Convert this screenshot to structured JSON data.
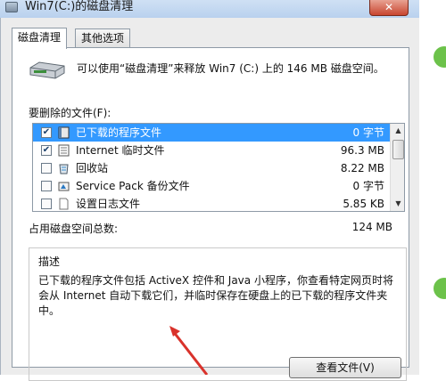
{
  "window": {
    "title": "Win7(C:)的磁盘清理",
    "close_label": "✕"
  },
  "tabs": [
    {
      "label": "磁盘清理",
      "active": true
    },
    {
      "label": "其他选项",
      "active": false
    }
  ],
  "intro_text": "可以使用“磁盘清理”来释放 Win7 (C:) 上的 146 MB 磁盘空间。",
  "files_label": "要删除的文件(F):",
  "files": [
    {
      "name": "已下载的程序文件",
      "size": "0 字节",
      "checked": true,
      "selected": true,
      "icon": "folder-icon"
    },
    {
      "name": "Internet 临时文件",
      "size": "96.3 MB",
      "checked": true,
      "selected": false,
      "icon": "internet-files-icon"
    },
    {
      "name": "回收站",
      "size": "8.22 MB",
      "checked": false,
      "selected": false,
      "icon": "recycle-bin-icon"
    },
    {
      "name": "Service Pack 备份文件",
      "size": "0 字节",
      "checked": false,
      "selected": false,
      "icon": "backup-icon"
    },
    {
      "name": "设置日志文件",
      "size": "5.85 KB",
      "checked": false,
      "selected": false,
      "icon": "log-file-icon"
    }
  ],
  "total_label": "占用磁盘空间总数:",
  "total_value": "124 MB",
  "description": {
    "title": "描述",
    "text": "已下载的程序文件包括 ActiveX 控件和 Java 小程序，你查看特定网页时将会从 Internet 自动下载它们，并临时保存在硬盘上的已下载的程序文件夹中。",
    "view_button": "查看文件(V)"
  },
  "colors": {
    "selection": "#3399ff",
    "close_button": "#c8452f",
    "annotation_arrow": "#d9322b",
    "side_dot": "#6cc24a"
  }
}
